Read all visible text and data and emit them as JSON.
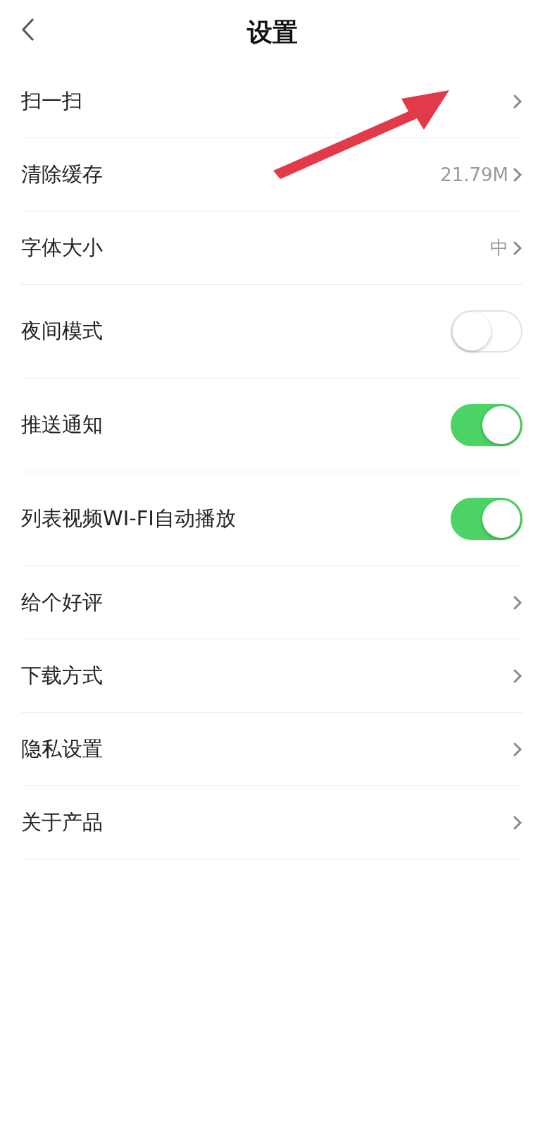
{
  "header": {
    "title": "设置"
  },
  "rows": [
    {
      "kind": "link",
      "label": "扫一扫"
    },
    {
      "kind": "link",
      "label": "清除缓存",
      "value": "21.79M"
    },
    {
      "kind": "link",
      "label": "字体大小",
      "value": "中"
    },
    {
      "kind": "toggle",
      "label": "夜间模式",
      "on": false
    },
    {
      "kind": "toggle",
      "label": "推送通知",
      "on": true
    },
    {
      "kind": "toggle",
      "label": "列表视频WI-FI自动播放",
      "on": true
    },
    {
      "kind": "link",
      "label": "给个好评"
    },
    {
      "kind": "link",
      "label": "下载方式"
    },
    {
      "kind": "link",
      "label": "隐私设置"
    },
    {
      "kind": "link",
      "label": "关于产品"
    }
  ]
}
